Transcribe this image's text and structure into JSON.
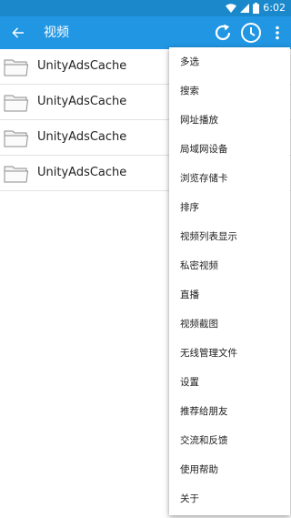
{
  "status_bar": {
    "time": "6:02",
    "icons": [
      "wifi-icon",
      "signal-icon",
      "battery-icon"
    ]
  },
  "app_bar": {
    "title": "视频",
    "icons": [
      "back-arrow-icon",
      "refresh-icon",
      "history-clock-icon",
      "more-vert-icon"
    ],
    "color": "#2196e3"
  },
  "file_list": {
    "items": [
      {
        "name": "UnityAdsCache",
        "icon": "folder-icon"
      },
      {
        "name": "UnityAdsCache",
        "icon": "folder-icon"
      },
      {
        "name": "UnityAdsCache",
        "icon": "folder-icon"
      },
      {
        "name": "UnityAdsCache",
        "icon": "folder-icon"
      }
    ]
  },
  "overflow_menu": {
    "items": [
      {
        "label": "多选"
      },
      {
        "label": "搜索"
      },
      {
        "label": "网址播放"
      },
      {
        "label": "局域网设备"
      },
      {
        "label": "浏览存储卡"
      },
      {
        "label": "排序"
      },
      {
        "label": "视频列表显示"
      },
      {
        "label": "私密视频"
      },
      {
        "label": "直播"
      },
      {
        "label": "视频截图"
      },
      {
        "label": "无线管理文件"
      },
      {
        "label": "设置"
      },
      {
        "label": "推荐给朋友"
      },
      {
        "label": "交流和反馈"
      },
      {
        "label": "使用帮助"
      },
      {
        "label": "关于"
      }
    ]
  }
}
